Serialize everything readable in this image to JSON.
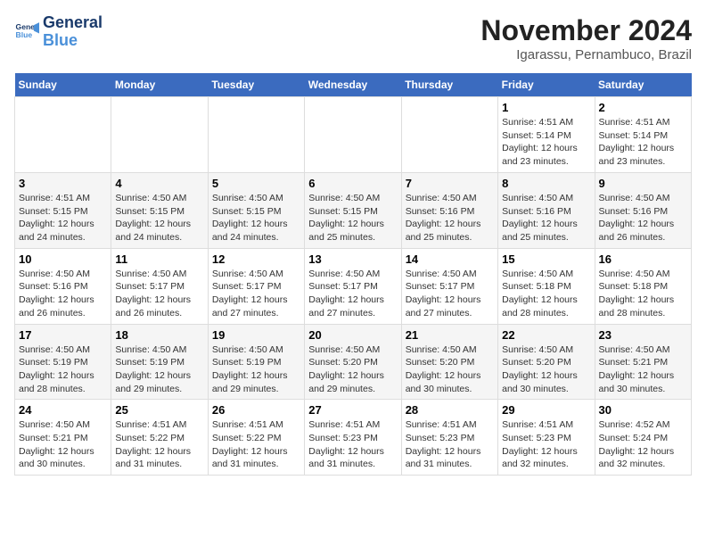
{
  "logo": {
    "line1": "General",
    "line2": "Blue"
  },
  "title": "November 2024",
  "subtitle": "Igarassu, Pernambuco, Brazil",
  "headers": [
    "Sunday",
    "Monday",
    "Tuesday",
    "Wednesday",
    "Thursday",
    "Friday",
    "Saturday"
  ],
  "weeks": [
    [
      {
        "day": "",
        "info": ""
      },
      {
        "day": "",
        "info": ""
      },
      {
        "day": "",
        "info": ""
      },
      {
        "day": "",
        "info": ""
      },
      {
        "day": "",
        "info": ""
      },
      {
        "day": "1",
        "info": "Sunrise: 4:51 AM\nSunset: 5:14 PM\nDaylight: 12 hours\nand 23 minutes."
      },
      {
        "day": "2",
        "info": "Sunrise: 4:51 AM\nSunset: 5:14 PM\nDaylight: 12 hours\nand 23 minutes."
      }
    ],
    [
      {
        "day": "3",
        "info": "Sunrise: 4:51 AM\nSunset: 5:15 PM\nDaylight: 12 hours\nand 24 minutes."
      },
      {
        "day": "4",
        "info": "Sunrise: 4:50 AM\nSunset: 5:15 PM\nDaylight: 12 hours\nand 24 minutes."
      },
      {
        "day": "5",
        "info": "Sunrise: 4:50 AM\nSunset: 5:15 PM\nDaylight: 12 hours\nand 24 minutes."
      },
      {
        "day": "6",
        "info": "Sunrise: 4:50 AM\nSunset: 5:15 PM\nDaylight: 12 hours\nand 25 minutes."
      },
      {
        "day": "7",
        "info": "Sunrise: 4:50 AM\nSunset: 5:16 PM\nDaylight: 12 hours\nand 25 minutes."
      },
      {
        "day": "8",
        "info": "Sunrise: 4:50 AM\nSunset: 5:16 PM\nDaylight: 12 hours\nand 25 minutes."
      },
      {
        "day": "9",
        "info": "Sunrise: 4:50 AM\nSunset: 5:16 PM\nDaylight: 12 hours\nand 26 minutes."
      }
    ],
    [
      {
        "day": "10",
        "info": "Sunrise: 4:50 AM\nSunset: 5:16 PM\nDaylight: 12 hours\nand 26 minutes."
      },
      {
        "day": "11",
        "info": "Sunrise: 4:50 AM\nSunset: 5:17 PM\nDaylight: 12 hours\nand 26 minutes."
      },
      {
        "day": "12",
        "info": "Sunrise: 4:50 AM\nSunset: 5:17 PM\nDaylight: 12 hours\nand 27 minutes."
      },
      {
        "day": "13",
        "info": "Sunrise: 4:50 AM\nSunset: 5:17 PM\nDaylight: 12 hours\nand 27 minutes."
      },
      {
        "day": "14",
        "info": "Sunrise: 4:50 AM\nSunset: 5:17 PM\nDaylight: 12 hours\nand 27 minutes."
      },
      {
        "day": "15",
        "info": "Sunrise: 4:50 AM\nSunset: 5:18 PM\nDaylight: 12 hours\nand 28 minutes."
      },
      {
        "day": "16",
        "info": "Sunrise: 4:50 AM\nSunset: 5:18 PM\nDaylight: 12 hours\nand 28 minutes."
      }
    ],
    [
      {
        "day": "17",
        "info": "Sunrise: 4:50 AM\nSunset: 5:19 PM\nDaylight: 12 hours\nand 28 minutes."
      },
      {
        "day": "18",
        "info": "Sunrise: 4:50 AM\nSunset: 5:19 PM\nDaylight: 12 hours\nand 29 minutes."
      },
      {
        "day": "19",
        "info": "Sunrise: 4:50 AM\nSunset: 5:19 PM\nDaylight: 12 hours\nand 29 minutes."
      },
      {
        "day": "20",
        "info": "Sunrise: 4:50 AM\nSunset: 5:20 PM\nDaylight: 12 hours\nand 29 minutes."
      },
      {
        "day": "21",
        "info": "Sunrise: 4:50 AM\nSunset: 5:20 PM\nDaylight: 12 hours\nand 30 minutes."
      },
      {
        "day": "22",
        "info": "Sunrise: 4:50 AM\nSunset: 5:20 PM\nDaylight: 12 hours\nand 30 minutes."
      },
      {
        "day": "23",
        "info": "Sunrise: 4:50 AM\nSunset: 5:21 PM\nDaylight: 12 hours\nand 30 minutes."
      }
    ],
    [
      {
        "day": "24",
        "info": "Sunrise: 4:50 AM\nSunset: 5:21 PM\nDaylight: 12 hours\nand 30 minutes."
      },
      {
        "day": "25",
        "info": "Sunrise: 4:51 AM\nSunset: 5:22 PM\nDaylight: 12 hours\nand 31 minutes."
      },
      {
        "day": "26",
        "info": "Sunrise: 4:51 AM\nSunset: 5:22 PM\nDaylight: 12 hours\nand 31 minutes."
      },
      {
        "day": "27",
        "info": "Sunrise: 4:51 AM\nSunset: 5:23 PM\nDaylight: 12 hours\nand 31 minutes."
      },
      {
        "day": "28",
        "info": "Sunrise: 4:51 AM\nSunset: 5:23 PM\nDaylight: 12 hours\nand 31 minutes."
      },
      {
        "day": "29",
        "info": "Sunrise: 4:51 AM\nSunset: 5:23 PM\nDaylight: 12 hours\nand 32 minutes."
      },
      {
        "day": "30",
        "info": "Sunrise: 4:52 AM\nSunset: 5:24 PM\nDaylight: 12 hours\nand 32 minutes."
      }
    ]
  ]
}
